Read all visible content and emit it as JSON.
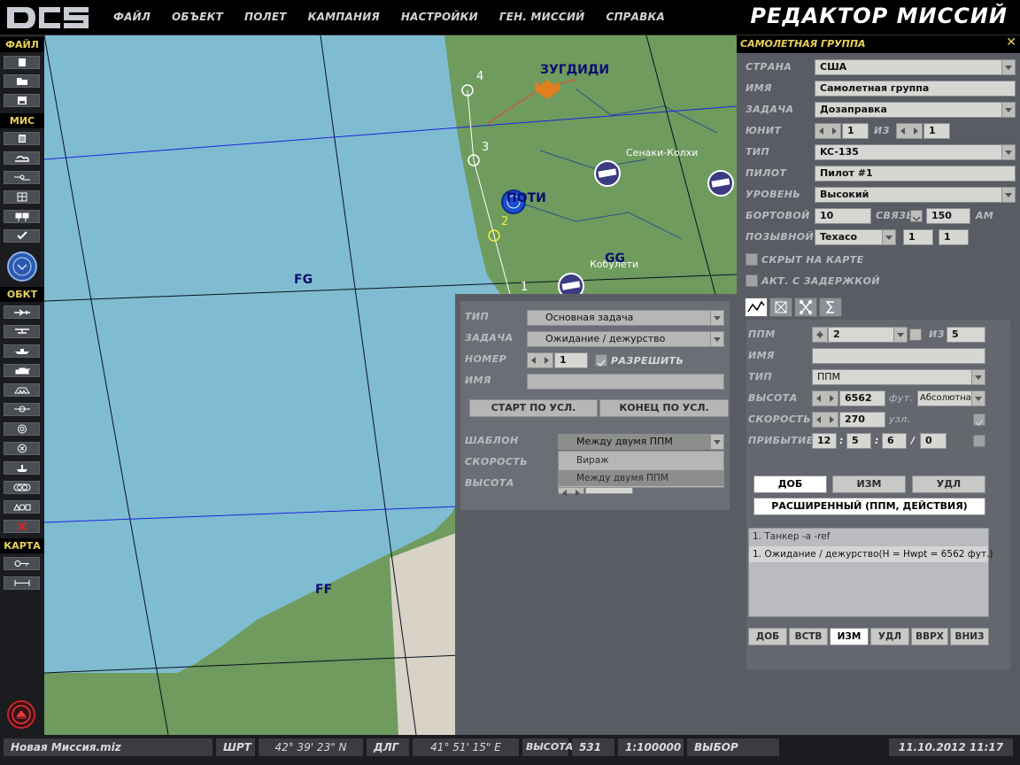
{
  "app": {
    "title": "РЕДАКТОР МИССИЙ"
  },
  "menu": [
    "ФАЙЛ",
    "ОБЪЕКТ",
    "ПОЛЕТ",
    "КАМПАНИЯ",
    "НАСТРОЙКИ",
    "ГЕН. МИССИЙ",
    "СПРАВКА"
  ],
  "left_toolbar": {
    "file": "ФАЙЛ",
    "mission": "МИС",
    "objects": "ОБКТ",
    "map": "КАРТА"
  },
  "map": {
    "cities": [
      {
        "name": "ЗУГДИДИ"
      },
      {
        "name": "ПОТИ"
      },
      {
        "name": "Сенаки-Колхи"
      },
      {
        "name": "Кобулети"
      }
    ],
    "grid_squares": [
      "FG",
      "FF",
      "GG"
    ],
    "waypoints": [
      "1",
      "2",
      "3",
      "4"
    ]
  },
  "group_panel": {
    "title": "САМОЛЕТНАЯ ГРУППА",
    "country_label": "СТРАНА",
    "country": "США",
    "name_label": "ИМЯ",
    "name": "Самолетная группа",
    "task_label": "ЗАДАЧА",
    "task": "Дозаправка",
    "unit_label": "ЮНИТ",
    "unit": "1",
    "of_label": "ИЗ",
    "unit_total": "1",
    "type_label": "ТИП",
    "type": "KC-135",
    "pilot_label": "ПИЛОТ",
    "pilot": "Пилот #1",
    "skill_label": "УРОВЕНЬ",
    "skill": "Высокий",
    "board_label": "БОРТОВОЙ",
    "board": "10",
    "radio_label": "СВЯЗЬ",
    "radio": "150",
    "radio_unit": "AM",
    "callsign_label": "ПОЗЫВНОЙ",
    "callsign": "Texaco",
    "callsign_n1": "1",
    "callsign_n2": "1",
    "hidden_label": "СКРЫТ НА КАРТЕ",
    "late_label": "АКТ. С ЗАДЕРЖКОЙ"
  },
  "waypoint_panel": {
    "wp_label": "ППМ",
    "wp": "2",
    "of_label": "ИЗ",
    "wp_total": "5",
    "name_label": "ИМЯ",
    "name": "",
    "type_label": "ТИП",
    "type": "ППМ",
    "alt_label": "ВЫСОТА",
    "alt": "6562",
    "alt_unit": "фут.",
    "alt_type": "Абсолютна",
    "speed_label": "СКОРОСТЬ",
    "speed": "270",
    "speed_unit": "узл.",
    "eta_label": "ПРИБЫТИЕ",
    "eta": [
      "12",
      "5",
      "6",
      "0"
    ],
    "btn_add": "ДОБ",
    "btn_edit": "ИЗМ",
    "btn_del": "УДЛ",
    "advanced": "РАСШИРЕННЫЙ (ППМ, ДЕЙСТВИЯ)",
    "actions": [
      "1. Танкер -a -ref",
      "1. Ожидание / дежурство(H = Hwpt = 6562 фут.)"
    ],
    "bottom_buttons": [
      "ДОБ",
      "ВСТВ",
      "ИЗМ",
      "УДЛ",
      "ВВРХ",
      "ВНИЗ"
    ]
  },
  "task_popup": {
    "type_label": "ТИП",
    "type": "Основная задача",
    "task_label": "ЗАДАЧА",
    "task": "Ожидание / дежурство",
    "number_label": "НОМЕР",
    "number": "1",
    "enable_label": "РАЗРЕШИТЬ",
    "name_label": "ИМЯ",
    "name": "",
    "start_btn": "СТАРТ ПО УСЛ.",
    "stop_btn": "КОНЕЦ ПО УСЛ.",
    "template_label": "ШАБЛОН",
    "template": "Между двумя ППМ",
    "template_options": [
      "Вираж",
      "Между двумя ППМ"
    ],
    "speed_label": "СКОРОСТЬ",
    "alt_label": "ВЫСОТА"
  },
  "status_bar": {
    "file": "Новая Миссия.miz",
    "lat_label": "ШРТ",
    "lat": "42° 39' 23\" N",
    "lon_label": "ДЛГ",
    "lon": "41° 51' 15\" E",
    "alt_label": "ВЫСОТА",
    "alt": "531",
    "scale": "1:100000",
    "mode": "ВЫБОР",
    "datetime": "11.10.2012 11:17"
  }
}
